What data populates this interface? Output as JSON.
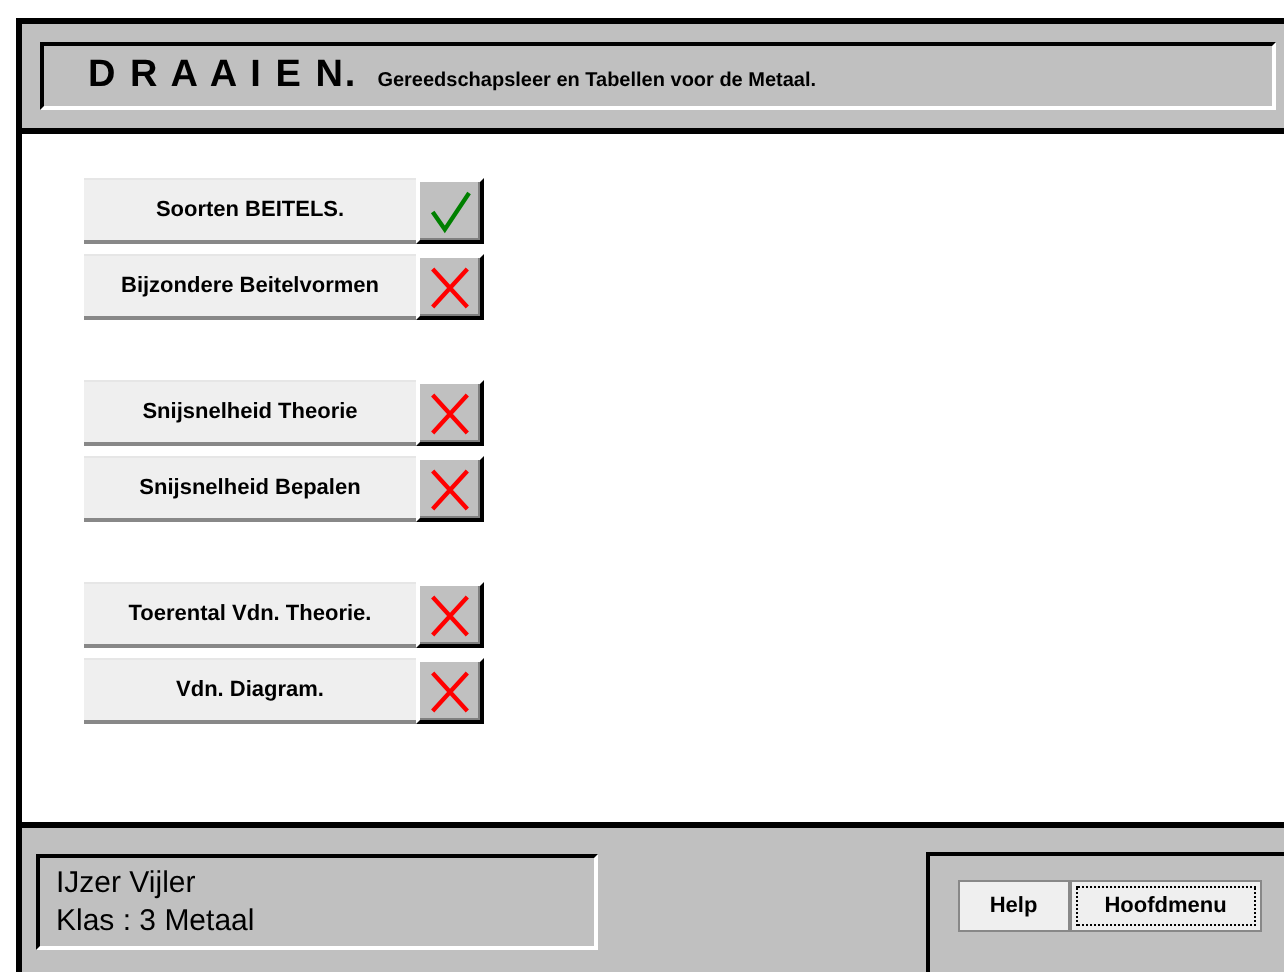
{
  "header": {
    "title": "D R A A I E N.",
    "subtitle": "Gereedschapsleer en Tabellen voor de Metaal."
  },
  "groups": [
    {
      "items": [
        {
          "label": "Soorten BEITELS.",
          "done": true
        },
        {
          "label": "Bijzondere Beitelvormen",
          "done": false
        }
      ]
    },
    {
      "items": [
        {
          "label": "Snijsnelheid Theorie",
          "done": false
        },
        {
          "label": "Snijsnelheid Bepalen",
          "done": false
        }
      ]
    },
    {
      "items": [
        {
          "label": "Toerental Vdn. Theorie.",
          "done": false
        },
        {
          "label": "Vdn. Diagram.",
          "done": false
        }
      ]
    }
  ],
  "user": {
    "name": "IJzer Vijler",
    "class": "Klas : 3 Metaal"
  },
  "buttons": [
    {
      "label": "Help",
      "focused": false
    },
    {
      "label": "Hoofdmenu",
      "focused": true
    }
  ]
}
